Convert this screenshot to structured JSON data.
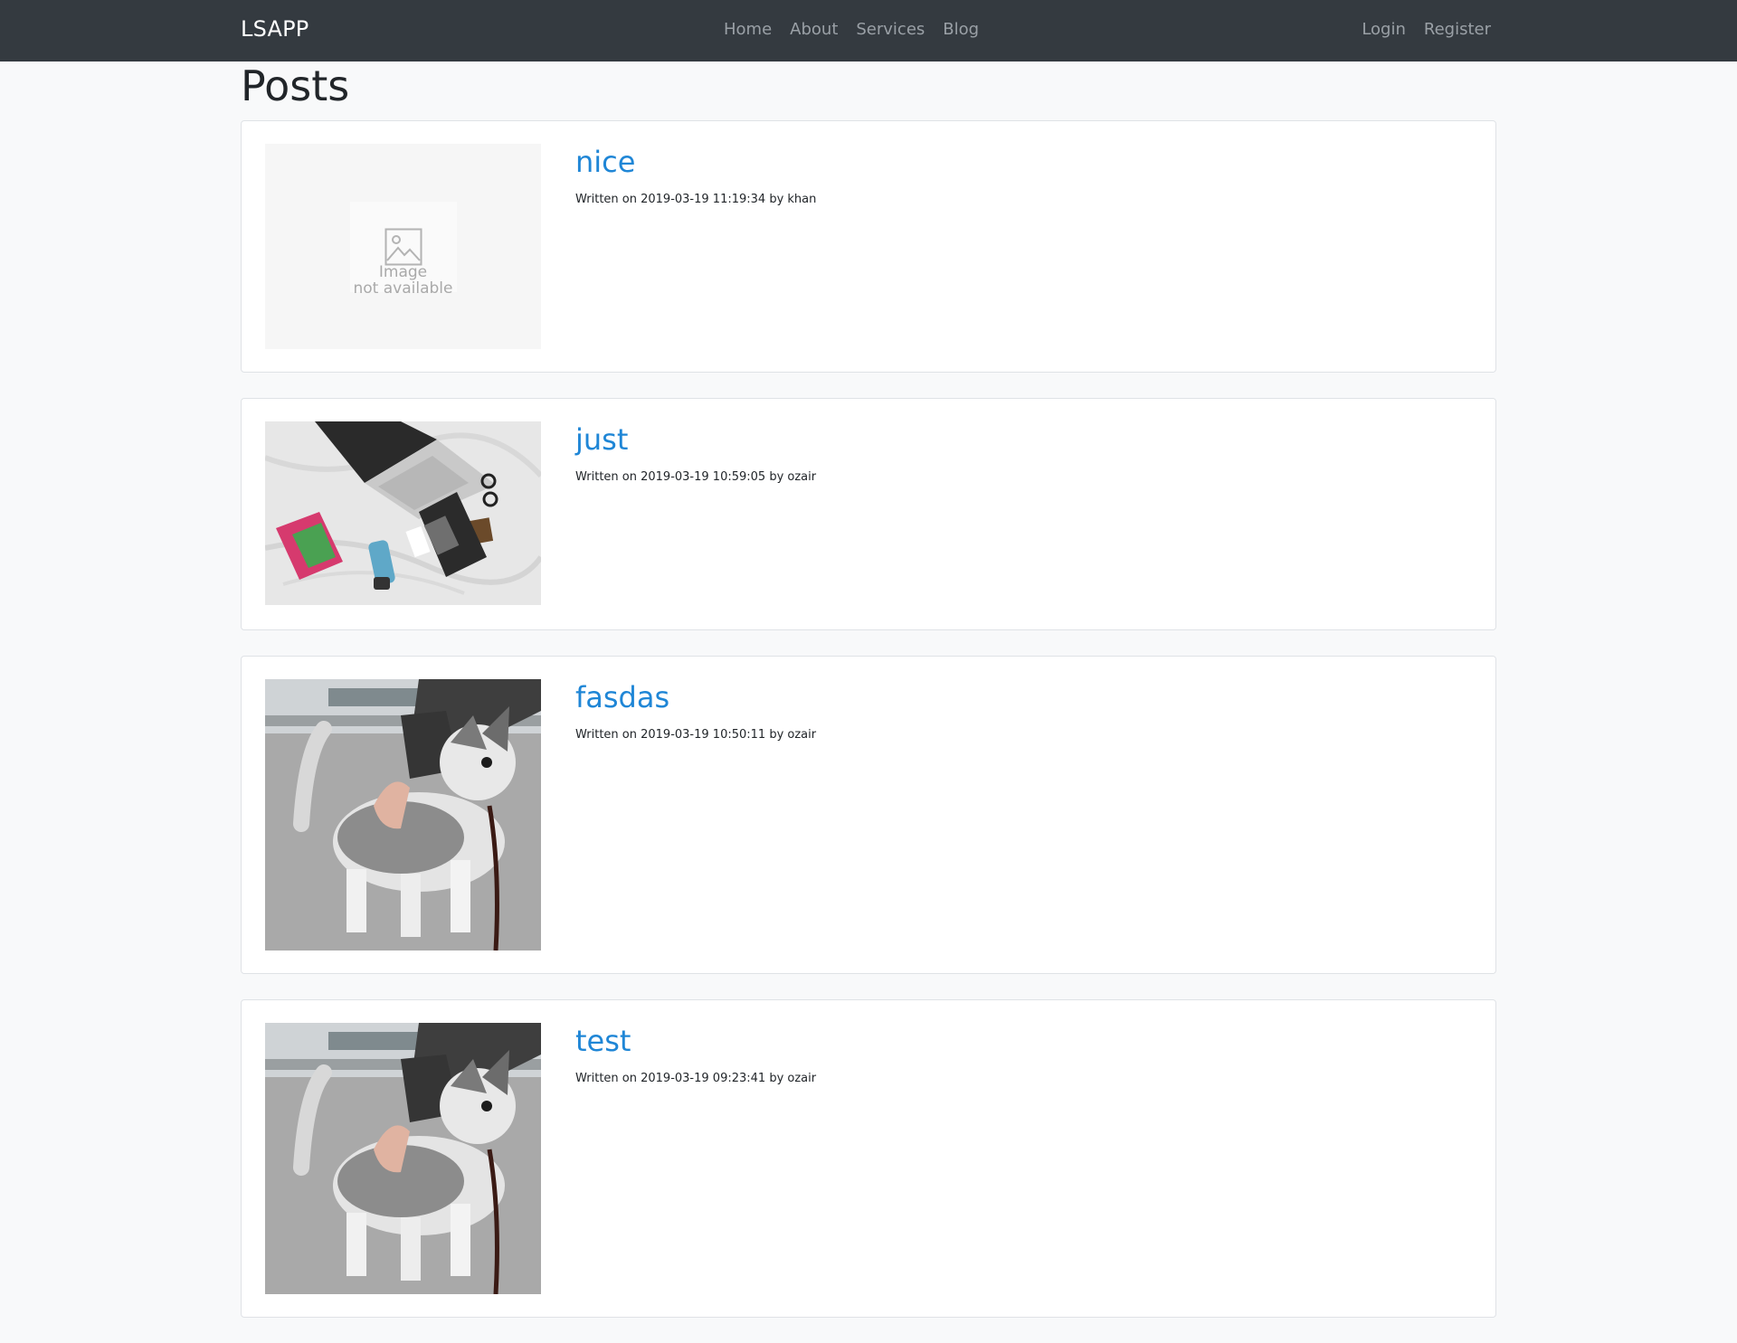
{
  "navbar": {
    "brand": "LSAPP",
    "links": [
      "Home",
      "About",
      "Services",
      "Blog"
    ],
    "auth": [
      "Login",
      "Register"
    ]
  },
  "page": {
    "title": "Posts"
  },
  "posts": [
    {
      "title": "nice",
      "meta": "Written on 2019-03-19 11:19:34 by khan",
      "image": "image-not-available",
      "image_text": [
        "Image",
        "not available"
      ]
    },
    {
      "title": "just",
      "meta": "Written on 2019-03-19 10:59:05 by ozair",
      "image": "laptop-desk-photo"
    },
    {
      "title": "fasdas",
      "meta": "Written on 2019-03-19 10:50:11 by ozair",
      "image": "husky-puppy-photo"
    },
    {
      "title": "test",
      "meta": "Written on 2019-03-19 09:23:41 by ozair",
      "image": "husky-puppy-photo"
    }
  ]
}
